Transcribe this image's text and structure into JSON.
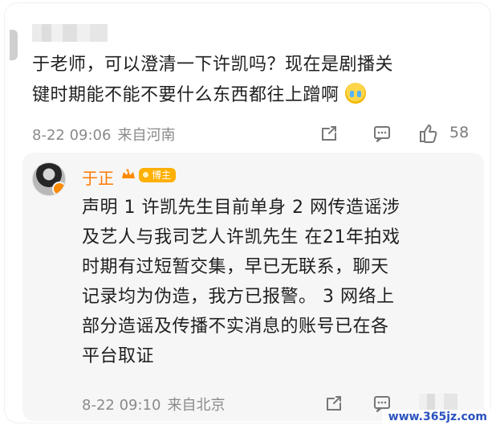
{
  "comment": {
    "text_line1": "于老师，可以澄清一下许凯吗？现在是剧播关",
    "text_line2": "键时期能不能不要什么东西都往上蹭啊",
    "time": "8-22 09:06",
    "location": "来自河南",
    "like_count": "58"
  },
  "reply": {
    "author": "于正",
    "badge": "博主",
    "text": "声明 1 许凯先生目前单身 2 网传造谣涉\n及艺人与我司艺人许凯先生 在21年拍戏\n时期有过短暂交集，早已无联系，聊天\n记录均为伪造，我方已报警。 3 网络上\n部分造谣及传播不实消息的账号已在各\n平台取证",
    "time": "8-22 09:10",
    "location": "来自北京"
  },
  "watermark": "www.365jz.com",
  "icons": {
    "share": "share-icon",
    "comment": "comment-icon",
    "like": "thumbs-up-icon",
    "crown": "crown-icon",
    "emoji": "crying-emoji-icon"
  },
  "colors": {
    "background": "#ffffff",
    "reply_card": "#f6f6f6",
    "author_name": "#ff7a00",
    "badge": "#ffb000",
    "meta_text": "#8a8a8a",
    "watermark": "#2a52be"
  }
}
